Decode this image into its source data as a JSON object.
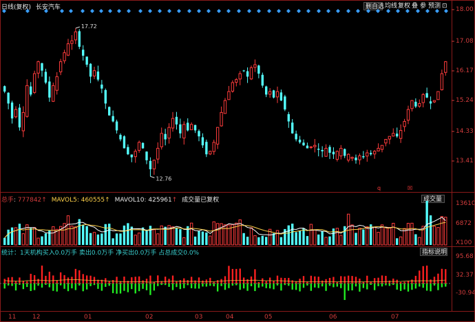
{
  "main_header": {
    "title": "日线(复权)",
    "stock": "长安汽车"
  },
  "toolbar": {
    "add_label": "删自选",
    "ma_label": "均线",
    "adjust_label": "复权",
    "overlay_label": "叠",
    "settings_label": "参",
    "forecast_label": "预测",
    "more_label": "⊡"
  },
  "price_axis": {
    "labels": [
      "18.00",
      "17.08",
      "16.17",
      "15.24",
      "14.33",
      "13.41"
    ]
  },
  "annotations": {
    "high": "17.72",
    "low": "12.76",
    "q_marker": "q",
    "k_marker": "☒"
  },
  "volume_header": {
    "total_label": "总手",
    "total_value": "777842",
    "mavol5_label": "MAVOL5",
    "mavol5_value": "460555",
    "mavol10_label": "MAVOL10",
    "mavol10_value": "425961",
    "note": "成交量已复权",
    "panel_button": "成交量"
  },
  "volume_axis": {
    "labels": [
      "13610",
      "6872",
      "X100"
    ]
  },
  "inst_header": {
    "text": "统计：1天机构买入0.0万手 卖出0.0万手 净买出0.0万手 占总成交0.0%",
    "panel_button": "指标说明"
  },
  "inst_axis": {
    "labels": [
      "95.68",
      "32.37",
      "-30.94"
    ]
  },
  "date_axis": {
    "labels": [
      "11",
      "12",
      "01",
      "02",
      "03",
      "04",
      "05",
      "06",
      "07"
    ]
  },
  "colors": {
    "up": "#ff3c3c",
    "down": "#54ffff",
    "ma5": "#ffffff",
    "ma10": "#ffd24a",
    "inst_pos": "#ff2020",
    "inst_neg": "#22ee22",
    "diamond": "#3aa0ff"
  },
  "chart_data": {
    "type": "candlestick",
    "x_start_label": "11",
    "y_high_marker": 17.72,
    "y_low_marker": 12.76,
    "ylim": [
      13.0,
      18.0
    ],
    "close_series": [
      15.6,
      15.2,
      14.7,
      15.0,
      14.4,
      14.9,
      15.8,
      15.5,
      16.2,
      16.6,
      16.3,
      15.9,
      15.4,
      15.8,
      16.1,
      16.6,
      16.9,
      17.2,
      17.3,
      17.6,
      17.1,
      16.8,
      16.5,
      16.1,
      16.3,
      16.0,
      15.7,
      15.2,
      14.8,
      14.6,
      14.3,
      14.0,
      13.7,
      13.5,
      13.4,
      13.6,
      13.9,
      13.7,
      13.3,
      13.0,
      13.3,
      13.7,
      14.2,
      14.0,
      14.4,
      14.7,
      14.5,
      14.2,
      14.5,
      14.3,
      14.5,
      14.3,
      14.1,
      13.8,
      13.5,
      13.6,
      13.9,
      14.4,
      14.9,
      15.3,
      15.6,
      15.9,
      16.0,
      16.2,
      16.3,
      16.1,
      16.4,
      16.5,
      16.2,
      15.8,
      15.5,
      15.6,
      15.4,
      15.6,
      15.3,
      15.0,
      14.6,
      14.2,
      14.0,
      13.9,
      13.8,
      13.7,
      13.75,
      13.8,
      13.65,
      13.6,
      13.7,
      13.55,
      13.5,
      13.6,
      13.7,
      13.45,
      13.5,
      13.4,
      13.3,
      13.45,
      13.4,
      13.55,
      13.5,
      13.6,
      13.7,
      13.8,
      14.0,
      14.1,
      14.2,
      14.1,
      14.3,
      14.6,
      15.0,
      15.3,
      15.1,
      15.2,
      15.5,
      15.4,
      15.2,
      15.3,
      15.6,
      16.2,
      16.6
    ],
    "volume_axis_max": 13610,
    "volume_unit": "X100",
    "inst_axis_max": 95.68,
    "inst_axis_min": -30.94
  }
}
